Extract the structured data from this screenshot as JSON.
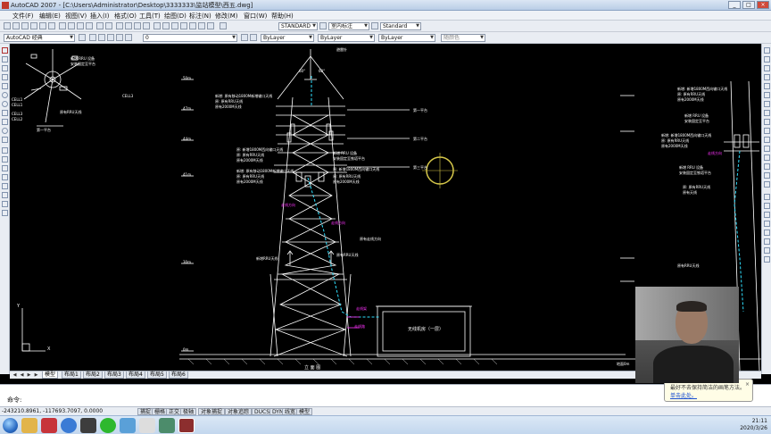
{
  "window": {
    "title": "AutoCAD 2007 - [C:\\Users\\Administrator\\Desktop\\3333333\\监站模型\\西五.dwg]",
    "controls": [
      "_",
      "□",
      "×"
    ]
  },
  "menu": [
    "文件(F)",
    "编辑(E)",
    "视图(V)",
    "插入(I)",
    "格式(O)",
    "工具(T)",
    "绘图(D)",
    "标注(N)",
    "修改(M)",
    "窗口(W)",
    "帮助(H)"
  ],
  "toolbar1": {
    "text_style": "STANDARD",
    "dim_style": "室内标注",
    "table_style": "Standard"
  },
  "toolbar2": {
    "workspace": "AutoCAD 经典",
    "layer": "0",
    "color": "ByLayer",
    "linetype": "ByLayer",
    "lineweight": "ByLayer",
    "plotstyle": "随颜色"
  },
  "drawing": {
    "top_label": "避雷针",
    "angle_left": "60°",
    "angle_right": "60°",
    "platforms": [
      "第一平台",
      "第二平台",
      "第三平台"
    ],
    "left_detail_title": "第一平台",
    "left_detail_tags": [
      "CELL3",
      "CELL2",
      "CELL1",
      "CELL1",
      "CELL3",
      "原有RRU天线"
    ],
    "top_left_notes": [
      "新增 RRU 设备",
      "安装固定至平台"
    ],
    "center_notes_a": [
      "新增: 原有移动1800M新增输口天线",
      "原: 原有RRU天线",
      "原有2000M天线"
    ],
    "center_notes_b": [
      "原: 新增1800M西向输口天线",
      "原: 原有RRU天线",
      "原有2000M天线"
    ],
    "center_notes_c": [
      "新增: 原有移动1800M新增输口天线",
      "原: 原有RRU天线",
      "原有2000M天线"
    ],
    "center_notes_d": [
      "新增 RRU 设备",
      "安装固定至铁塔平台"
    ],
    "right_notes_a": [
      "新增 RRU 设备",
      "安装固定至平台"
    ],
    "right_notes_b": [
      "新增: 新增1800M西向输口天线",
      "原: 原有RRU天线",
      "原有2000M天线"
    ],
    "right_notes_c": [
      "新增 RRU 设备",
      "安装固定至铁塔平台"
    ],
    "right_notes_d": [
      "原: 原有RRU天线",
      "原有天线"
    ],
    "right_notes_e": [
      "新增: 新增1800M西向输口天线",
      "原: 原有RRU天线",
      "原有2000M天线"
    ],
    "magenta_labels": [
      "走线方向",
      "走线方向",
      "走线架",
      "走线路",
      "走线方向"
    ],
    "tower_notes": [
      "新增RRU天线",
      "原有RRU天线",
      "原有RRU天线",
      "原有天线",
      "新增馈线",
      "原有走线方向"
    ],
    "elevations": [
      "50m",
      "47m",
      "44m",
      "41m",
      "35m",
      "30m",
      "0m"
    ],
    "cabinet_label": "无线机房（一层）",
    "bottom_label": "立 面 图",
    "bottom_right_label": "地面0m",
    "right_note_bottom": "原有RRU天线"
  },
  "layout_tabs": [
    "模型",
    "布局1",
    "布局2",
    "布局3",
    "布局4",
    "布局5",
    "布局6"
  ],
  "command": {
    "prompt": "命令:"
  },
  "status": {
    "coords": "-243210.8961, -117693.7097, 0.0000",
    "toggles": [
      "捕捉",
      "栅格",
      "正交",
      "极轴",
      "对象捕捉",
      "对象追踪",
      "DUCS",
      "DYN",
      "线宽",
      "模型"
    ]
  },
  "balloon": {
    "text": "最好不去保持简洁的画笔方法。",
    "link": "单击此处。",
    "close": "×"
  },
  "taskbar": {
    "time": "21:11",
    "date": "2020/3/26"
  },
  "colors": {
    "canvas": "#000000",
    "cad_white": "#ffffff",
    "cad_magenta": "#ff33ff",
    "cad_cyan": "#30e0ff",
    "cad_yellow": "#d6c84a"
  }
}
